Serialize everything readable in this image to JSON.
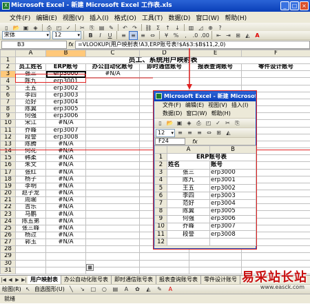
{
  "window": {
    "title": "Microsoft Excel - 新建 Microsoft Excel 工作表.xls"
  },
  "menu": [
    "文件(F)",
    "编辑(E)",
    "视图(V)",
    "插入(I)",
    "格式(O)",
    "工具(T)",
    "数据(D)",
    "窗口(W)",
    "帮助(H)"
  ],
  "format_toolbar": {
    "font": "宋体",
    "size": "12",
    "bold": "B",
    "italic": "I",
    "underline": "U"
  },
  "formula_bar": {
    "cell_ref": "B3",
    "fx": "fx",
    "formula": "=VLOOKUP(用户映射表!A3,ERP账号表!$A$3:$B$11,2,0)"
  },
  "sheet": {
    "columns": [
      "A",
      "B",
      "C",
      "D",
      "E",
      "F"
    ],
    "row_numbers": [
      "1",
      "2",
      "3",
      "4",
      "5",
      "6",
      "7",
      "8",
      "9",
      "10",
      "11",
      "12",
      "13",
      "14",
      "15",
      "16",
      "17",
      "18",
      "19",
      "20",
      "21",
      "22",
      "23",
      "24",
      "25",
      "26",
      "27",
      "28",
      "29",
      "30",
      "31"
    ],
    "title": "员工、系统用户映射表",
    "headers": [
      "员工姓名",
      "ERP账号",
      "办公自动化账号",
      "即时通信账号",
      "报表查询账号",
      "零件设计账号"
    ],
    "rows": [
      [
        "张三",
        "erp3000",
        "#N/A"
      ],
      [
        "陈九",
        "erp3001",
        ""
      ],
      [
        "王五",
        "erp3002",
        ""
      ],
      [
        "李四",
        "erp3003",
        ""
      ],
      [
        "范好",
        "erp3004",
        ""
      ],
      [
        "陈翼",
        "erp3005",
        ""
      ],
      [
        "何强",
        "erp3006",
        ""
      ],
      [
        "宋江",
        "#N/A",
        ""
      ],
      [
        "乔峰",
        "erp3007",
        ""
      ],
      [
        "段誉",
        "erp3008",
        ""
      ],
      [
        "陈腾",
        "#N/A",
        ""
      ],
      [
        "何花",
        "#N/A",
        ""
      ],
      [
        "韩柔",
        "#N/A",
        ""
      ],
      [
        "朱文",
        "#N/A",
        ""
      ],
      [
        "张红",
        "#N/A",
        ""
      ],
      [
        "杨子",
        "#N/A",
        ""
      ],
      [
        "李明",
        "#N/A",
        ""
      ],
      [
        "赵子龙",
        "#N/A",
        ""
      ],
      [
        "周瑜",
        "#N/A",
        ""
      ],
      [
        "吉乐",
        "#N/A",
        ""
      ],
      [
        "马鹏",
        "#N/A",
        ""
      ],
      [
        "陈五弟",
        "#N/A",
        ""
      ],
      [
        "张三峰",
        "#N/A",
        ""
      ],
      [
        "杨过",
        "#N/A",
        ""
      ],
      [
        "郭玉",
        "#N/A",
        ""
      ]
    ]
  },
  "second_window": {
    "title": "Microsoft Excel - 新建 Microsoft",
    "menu": [
      "文件(F)",
      "编辑(E)",
      "视图(V)",
      "插入(I)",
      "数据(D)",
      "窗口(W)",
      "帮助(H)"
    ],
    "font_size": "12",
    "cell_ref": "F24",
    "columns": [
      "A",
      "B"
    ],
    "title_cell": "ERP账号表",
    "headers": [
      "姓名",
      "账号"
    ],
    "rows": [
      [
        "张三",
        "erp3000"
      ],
      [
        "陈九",
        "erp3001"
      ],
      [
        "王五",
        "erp3002"
      ],
      [
        "李四",
        "erp3003"
      ],
      [
        "范好",
        "erp3004"
      ],
      [
        "陈翼",
        "erp3005"
      ],
      [
        "何强",
        "erp3006"
      ],
      [
        "乔峰",
        "erp3007"
      ],
      [
        "段誉",
        "erp3008"
      ]
    ],
    "row_numbers": [
      "1",
      "2",
      "3",
      "4",
      "5",
      "6",
      "7",
      "8",
      "9",
      "10",
      "11",
      "12"
    ]
  },
  "tabs": [
    "用户映射表",
    "办公自动化账号表",
    "即时通信账号表",
    "报表查询账号表",
    "零件设计账号"
  ],
  "drawing_toolbar": {
    "draw": "绘图(R)",
    "autoshape": "自选图形(U)"
  },
  "status": "就绪",
  "watermark": {
    "text": "易采站长站",
    "url": "www.easck.com"
  },
  "colors": {
    "title_blue": "#0a3fb8",
    "highlight_red": "#e02020",
    "header_orange": "#ffc87a"
  }
}
